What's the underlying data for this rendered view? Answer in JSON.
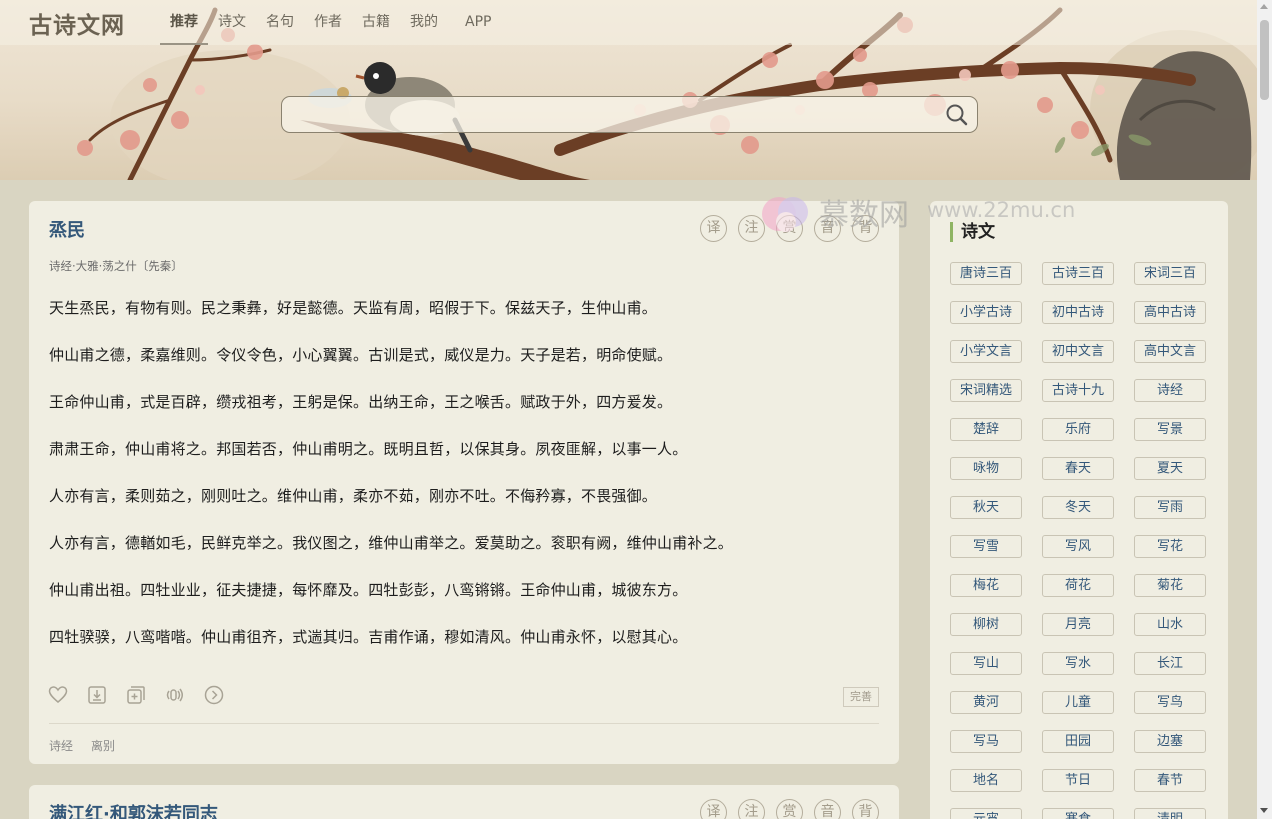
{
  "header": {
    "logo": "古诗文网",
    "nav": [
      "推荐",
      "诗文",
      "名句",
      "作者",
      "古籍",
      "我的",
      "APP"
    ],
    "active_nav": "推荐",
    "search_placeholder": ""
  },
  "watermark": {
    "text": "慕数网",
    "url": "www.22mu.cn"
  },
  "poem": {
    "title": "烝民",
    "seals": [
      "译",
      "注",
      "赏",
      "音",
      "背"
    ],
    "source": "诗经·大雅·荡之什〔先秦〕",
    "verses": [
      "天生烝民，有物有则。民之秉彝，好是懿德。天监有周，昭假于下。保兹天子，生仲山甫。",
      "仲山甫之德，柔嘉维则。令仪令色，小心翼翼。古训是式，威仪是力。天子是若，明命使赋。",
      "王命仲山甫，式是百辟，缵戎祖考，王躬是保。出纳王命，王之喉舌。赋政于外，四方爰发。",
      "肃肃王命，仲山甫将之。邦国若否，仲山甫明之。既明且哲，以保其身。夙夜匪解，以事一人。",
      "人亦有言，柔则茹之，刚则吐之。维仲山甫，柔亦不茹，刚亦不吐。不侮矜寡，不畏强御。",
      "人亦有言，德輶如毛，民鲜克举之。我仪图之，维仲山甫举之。爱莫助之。衮职有阙，维仲山甫补之。",
      "仲山甫出祖。四牡业业，征夫捷捷，每怀靡及。四牡彭彭，八鸾锵锵。王命仲山甫，城彼东方。",
      "四牡骙骙，八鸾喈喈。仲山甫徂齐，式遄其归。吉甫作诵，穆如清风。仲山甫永怀，以慰其心。"
    ],
    "perfect_label": "完善",
    "tags": [
      "诗经",
      "离别"
    ]
  },
  "poem2": {
    "title": "满江红·和郭沫若同志",
    "seals": [
      "译",
      "注",
      "赏",
      "音",
      "背"
    ]
  },
  "sidebar": {
    "title": "诗文",
    "items": [
      "唐诗三百",
      "古诗三百",
      "宋词三百",
      "小学古诗",
      "初中古诗",
      "高中古诗",
      "小学文言",
      "初中文言",
      "高中文言",
      "宋词精选",
      "古诗十九",
      "诗经",
      "楚辞",
      "乐府",
      "写景",
      "咏物",
      "春天",
      "夏天",
      "秋天",
      "冬天",
      "写雨",
      "写雪",
      "写风",
      "写花",
      "梅花",
      "荷花",
      "菊花",
      "柳树",
      "月亮",
      "山水",
      "写山",
      "写水",
      "长江",
      "黄河",
      "儿童",
      "写鸟",
      "写马",
      "田园",
      "边塞",
      "地名",
      "节日",
      "春节",
      "元宵",
      "寒食",
      "清明"
    ]
  },
  "colors": {
    "title_blue": "#34587a",
    "page_bg": "#d9d5c2",
    "card_bg": "#f0eee2",
    "accent_green": "#8fb463"
  }
}
